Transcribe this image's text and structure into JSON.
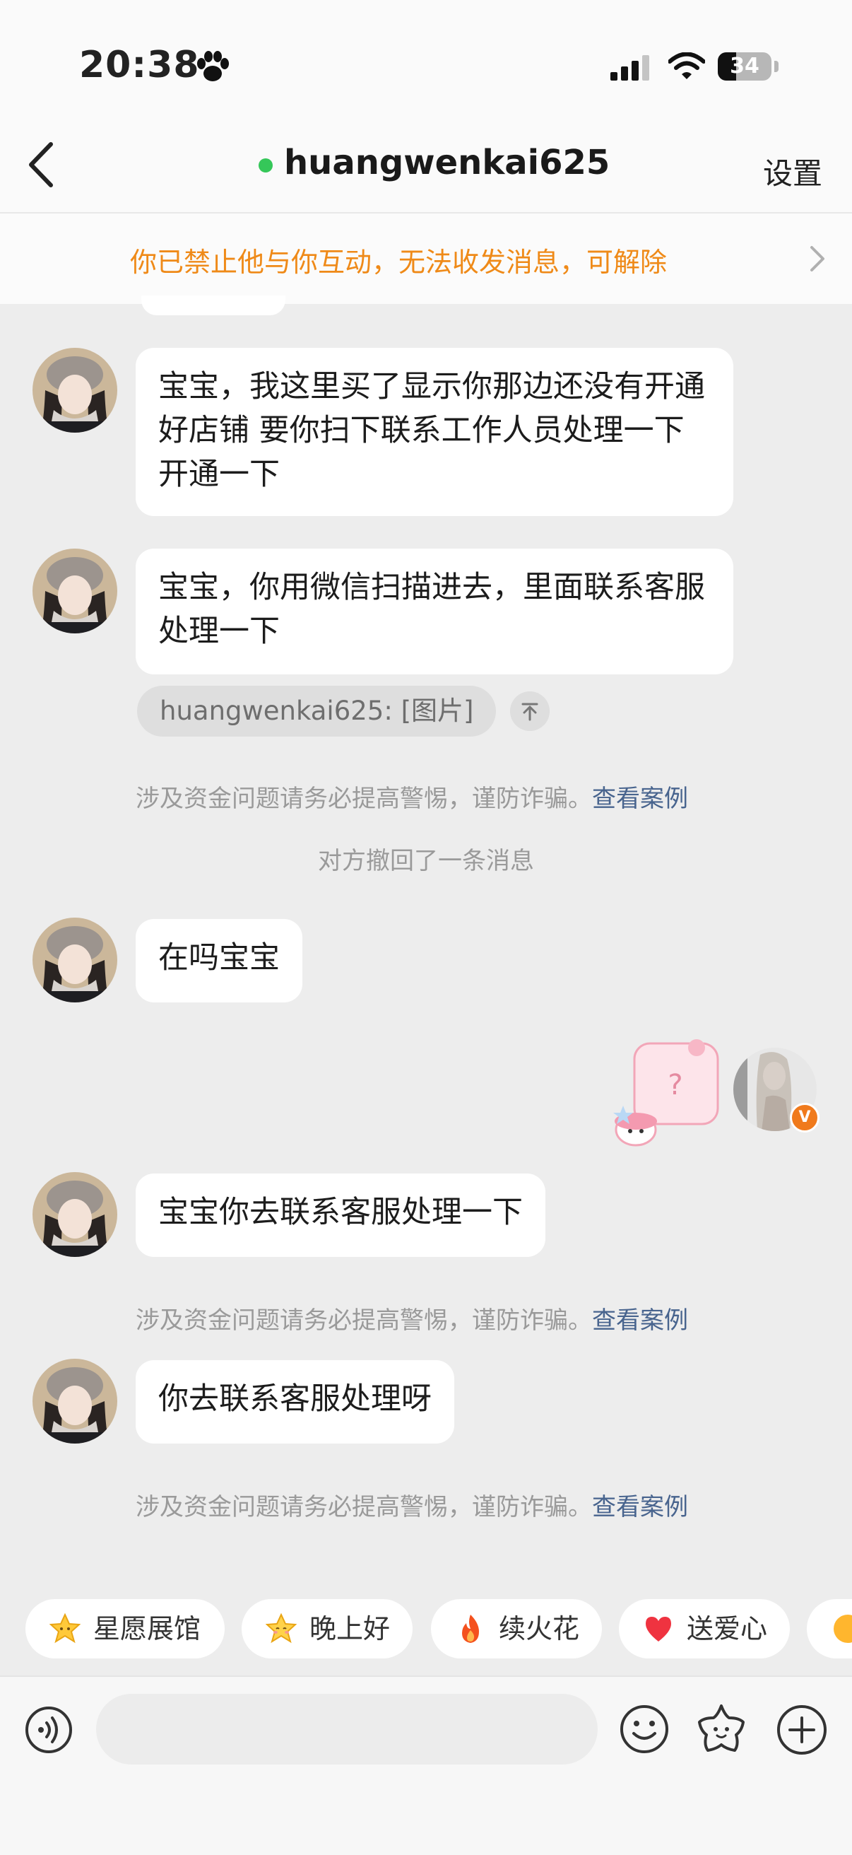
{
  "status_bar": {
    "time": "20:38",
    "battery": "34",
    "battery_level": 0.34
  },
  "header": {
    "title": "huangwenkai625",
    "settings_label": "设置"
  },
  "banner": {
    "text": "你已禁止他与你互动，无法收发消息，可解除"
  },
  "messages": [
    {
      "text": "宝宝，我这里买了显示你那边还没有开通好店铺 要你扫下联系工作人员处理一下开通一下"
    },
    {
      "text": "宝宝，你用微信扫描进去，里面联系客服处理一下"
    },
    {
      "text": "在吗宝宝"
    },
    {
      "text": "宝宝你去联系客服处理一下"
    },
    {
      "text": "你去联系客服处理呀"
    }
  ],
  "image_reference": "huangwenkai625: [图片]",
  "fraud_notice": {
    "text": "涉及资金问题请务必提高警惕，谨防诈骗。",
    "link": "查看案例"
  },
  "recall_notice": "对方撤回了一条消息",
  "sticker": {
    "symbol": "?"
  },
  "verified_badge": "V",
  "quick_replies": [
    {
      "label": "星愿展馆",
      "icon": "star-icon"
    },
    {
      "label": "晚上好",
      "icon": "star-face-icon"
    },
    {
      "label": "续火花",
      "icon": "fire-icon"
    },
    {
      "label": "送爱心",
      "icon": "heart-icon"
    }
  ],
  "colors": {
    "accent_orange": "#ef8a18",
    "link_blue": "#48648e",
    "online_green": "#35c759"
  }
}
